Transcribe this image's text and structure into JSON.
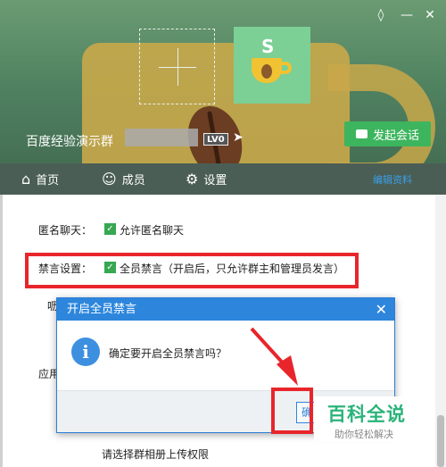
{
  "header": {
    "group_name": "百度经验演示群",
    "level_badge": "LV0",
    "start_chat_label": "发起会话",
    "icons": [
      "skin-icon",
      "minimize-icon",
      "close-icon",
      "add-avatar-icon",
      "share-icon",
      "chat-icon"
    ]
  },
  "tabs": [
    {
      "label": "首页",
      "icon": "home-icon"
    },
    {
      "label": "成员",
      "icon": "member-icon"
    },
    {
      "label": "设置",
      "icon": "gear-icon"
    }
  ],
  "tab_edit_label": "编辑资料",
  "settings": {
    "anonymous_label": "匿名聊天：",
    "anonymous_option": "允许匿名聊天",
    "mute_label": "禁言设置：",
    "mute_option": "全员禁言（开启后，只允许群主和管理员发言）",
    "partial_label_1": "呖",
    "partial_label_2": "应用",
    "upload_permission": "请选择群相册上传权限"
  },
  "dialog": {
    "title": "开启全员禁言",
    "message": "确定要开启全员禁言吗？",
    "confirm_label": "确"
  },
  "watermark": {
    "main": "百科全说",
    "sub": "助你轻松解决"
  },
  "colors": {
    "accent_green": "#3db55e",
    "dialog_blue": "#2d86dc",
    "highlight_red": "#e8252b"
  }
}
